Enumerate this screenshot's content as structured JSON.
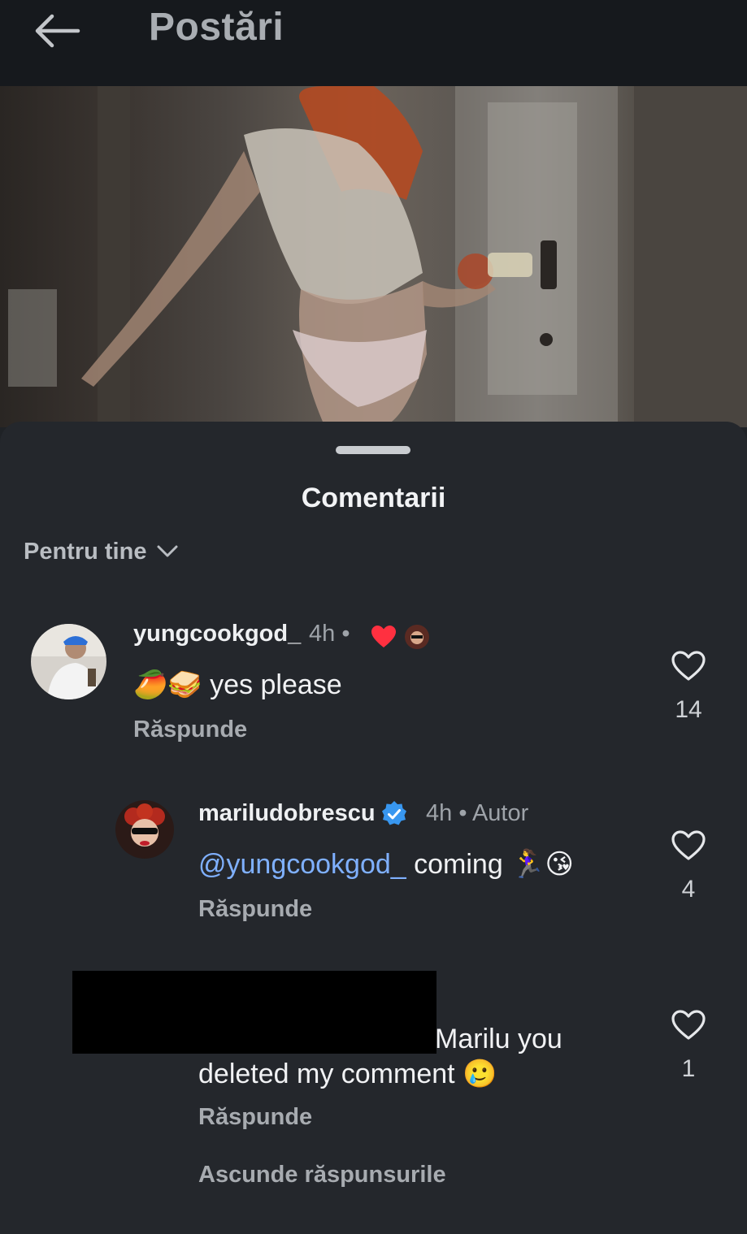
{
  "topbar": {
    "title": "Postări"
  },
  "sheet": {
    "title": "Comentarii",
    "filter_label": "Pentru tine"
  },
  "comments": [
    {
      "username": "yungcookgod_",
      "time": "4h",
      "text": "yes please",
      "emoji": "🥭🥪",
      "reply_label": "Răspunde",
      "likes": "14"
    },
    {
      "username": "mariludobrescu",
      "time": "4h",
      "author_badge": "Autor",
      "mention": "@yungcookgod_",
      "text": " coming ",
      "emoji": "🏃‍♀️😘",
      "reply_label": "Răspunde",
      "likes": "4"
    },
    {
      "text_line1": "Marilu you",
      "text_line2": "deleted my comment",
      "emoji": "🥲",
      "reply_label": "Răspunde",
      "likes": "1"
    }
  ],
  "hide_replies_label": "Ascunde răspunsurile",
  "colors": {
    "background": "#1f2226",
    "sheet": "#24272c",
    "mention": "#7fb0ff",
    "verified": "#3897f0",
    "heart_liked": "#ff3040"
  }
}
